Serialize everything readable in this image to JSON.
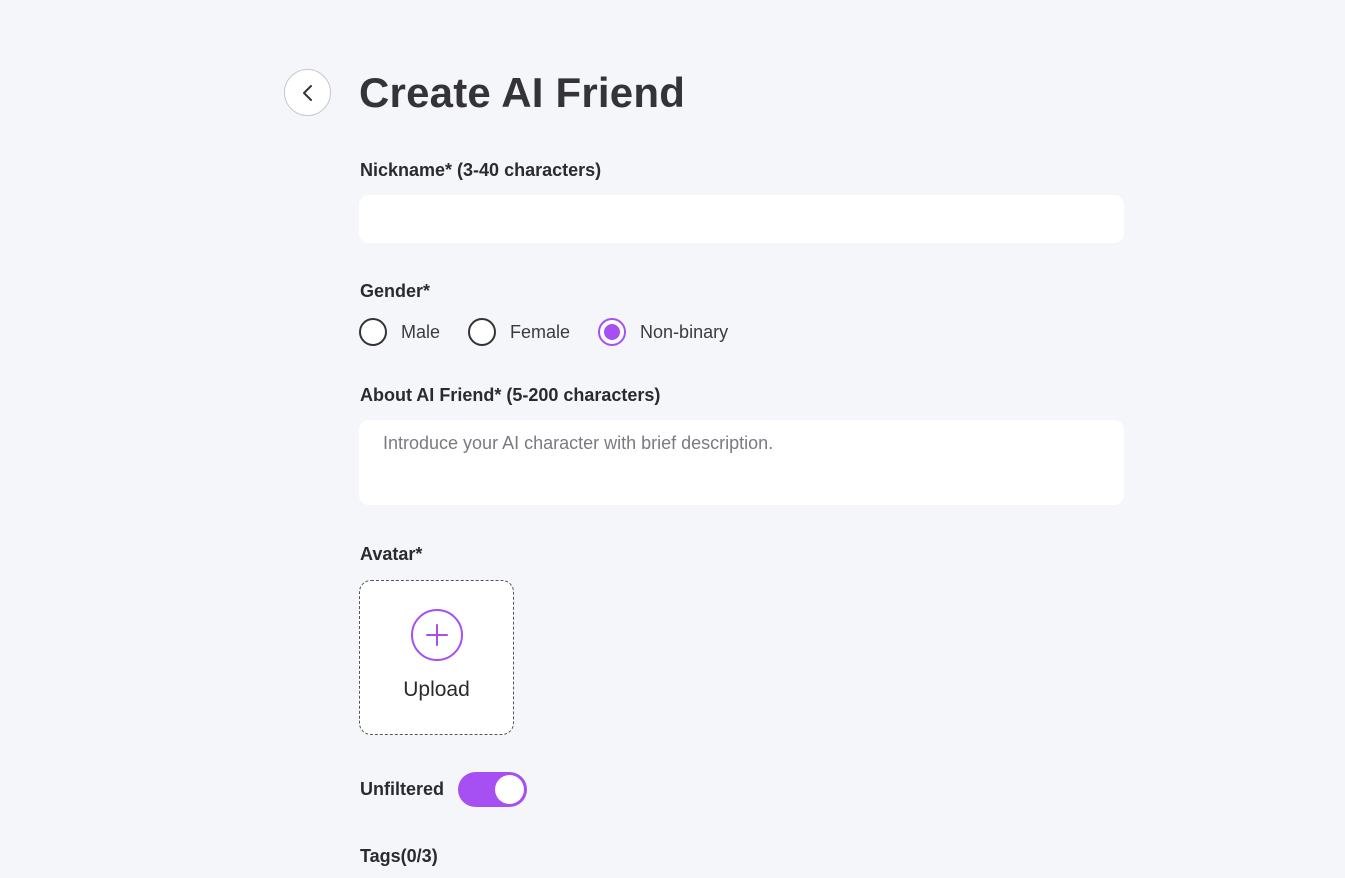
{
  "page": {
    "title": "Create AI Friend"
  },
  "form": {
    "nickname": {
      "label": "Nickname* (3-40 characters)",
      "value": "",
      "placeholder": ""
    },
    "gender": {
      "label": "Gender*",
      "options": [
        "Male",
        "Female",
        "Non-binary"
      ],
      "selected": "Non-binary"
    },
    "about": {
      "label": "About AI Friend* (5-200 characters)",
      "value": "",
      "placeholder": "Introduce your AI character with brief description."
    },
    "avatar": {
      "label": "Avatar*",
      "upload_label": "Upload",
      "icon": "plus-circle-icon"
    },
    "unfiltered": {
      "label": "Unfiltered",
      "enabled": true
    },
    "tags": {
      "label": "Tags(0/3)"
    }
  },
  "icons": {
    "back": "chevron-left-icon"
  },
  "colors": {
    "accent": "#a64ff2",
    "background": "#f5f6fa",
    "text": "#2b2b2f"
  }
}
